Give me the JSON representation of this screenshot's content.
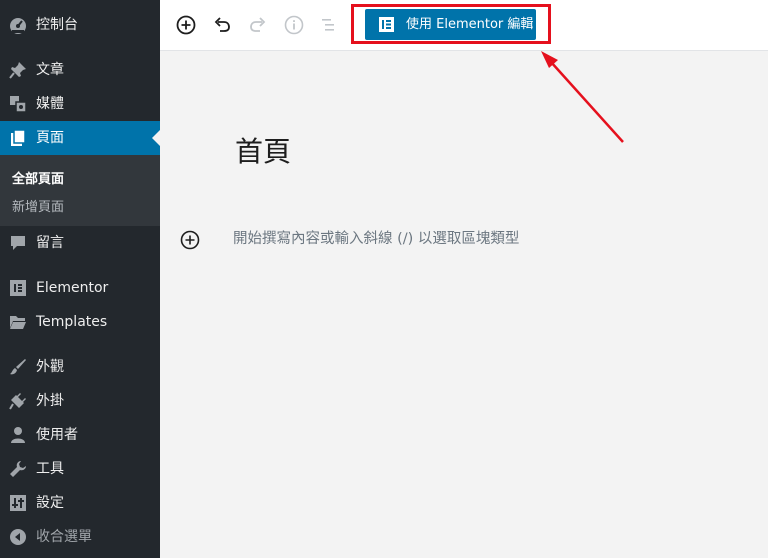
{
  "sidebar": {
    "items": [
      {
        "key": "dashboard",
        "label": "控制台",
        "icon": "dashboard-icon"
      },
      {
        "key": "posts",
        "label": "文章",
        "icon": "pin-icon"
      },
      {
        "key": "media",
        "label": "媒體",
        "icon": "media-icon"
      },
      {
        "key": "pages",
        "label": "頁面",
        "icon": "pages-icon",
        "active": true
      },
      {
        "key": "comments",
        "label": "留言",
        "icon": "comment-icon"
      },
      {
        "key": "elementor",
        "label": "Elementor",
        "icon": "elementor-icon"
      },
      {
        "key": "templates",
        "label": "Templates",
        "icon": "folder-icon"
      },
      {
        "key": "appearance",
        "label": "外觀",
        "icon": "brush-icon"
      },
      {
        "key": "plugins",
        "label": "外掛",
        "icon": "plugin-icon"
      },
      {
        "key": "users",
        "label": "使用者",
        "icon": "user-icon"
      },
      {
        "key": "tools",
        "label": "工具",
        "icon": "wrench-icon"
      },
      {
        "key": "settings",
        "label": "設定",
        "icon": "settings-icon"
      },
      {
        "key": "collapse",
        "label": "收合選單",
        "icon": "collapse-icon"
      }
    ],
    "submenu": [
      {
        "label": "全部頁面",
        "current": true
      },
      {
        "label": "新增頁面",
        "current": false
      }
    ]
  },
  "toolbar": {
    "icons": [
      "add-block-icon",
      "undo-icon",
      "redo-icon",
      "info-icon",
      "list-view-icon"
    ],
    "elementor_button_label": "使用 Elementor 編輯"
  },
  "editor": {
    "page_title": "首頁",
    "placeholder": "開始撰寫內容或輸入斜線 (/) 以選取區塊類型"
  },
  "colors": {
    "sidebar_bg": "#23282d",
    "accent": "#0073aa",
    "annotation": "#e5101d"
  }
}
